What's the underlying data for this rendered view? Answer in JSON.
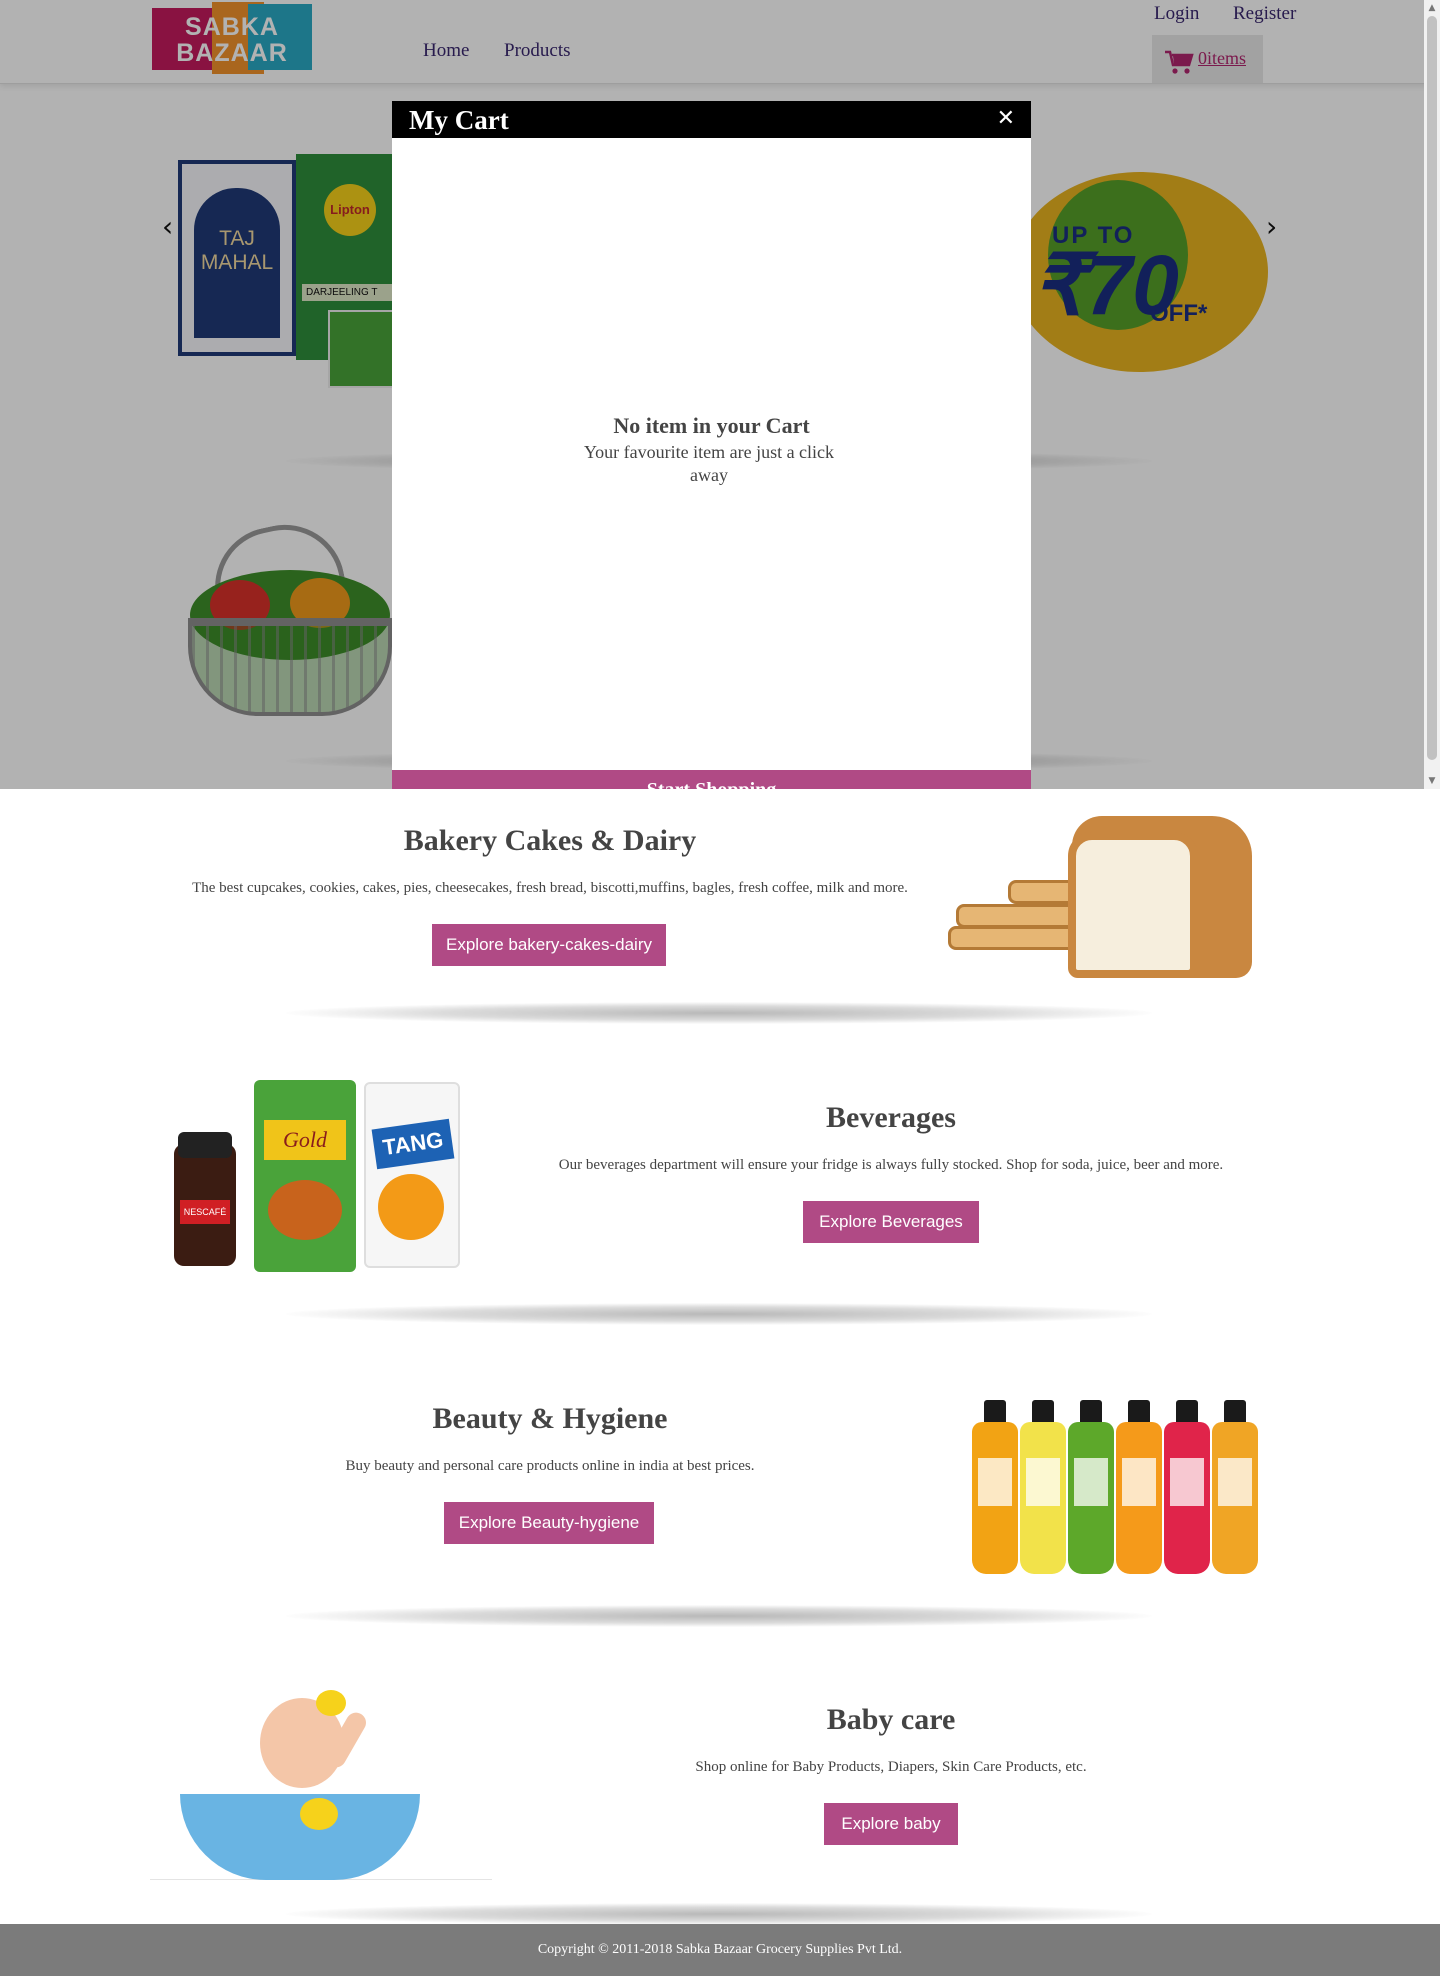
{
  "brand": {
    "logo_line1": "SABKA",
    "logo_line2": "BAZAAR",
    "colors": {
      "magenta": "#c41b5e",
      "orange": "#f2932b",
      "teal": "#2aaac4"
    }
  },
  "nav": {
    "home": "Home",
    "products": "Products"
  },
  "auth": {
    "login": "Login",
    "register": "Register"
  },
  "cart_button": {
    "icon": "cart-icon",
    "count_label": "0items"
  },
  "carousel": {
    "prev": "‹",
    "next": "›",
    "slide": {
      "taj_line1": "TAJ",
      "taj_line2": "MAHAL",
      "lipton": "Lipton",
      "lipton_variant": "DARJEELING T",
      "promo_up_to": "UP TO",
      "promo_value": "₹70",
      "promo_off": "OFF*"
    }
  },
  "categories": [
    {
      "title": "Bakery Cakes & Dairy",
      "description": "The best cupcakes, cookies, cakes, pies, cheesecakes, fresh bread, biscotti,muffins, bagles, fresh coffee, milk and more.",
      "button": "Explore bakery-cakes-dairy"
    },
    {
      "title": "Beverages",
      "description": "Our beverages department will ensure your fridge is always fully stocked. Shop for soda, juice, beer and more.",
      "button": "Explore Beverages",
      "packs": {
        "jar": "NESCAFÉ",
        "gold": "Gold",
        "tang": "TANG"
      }
    },
    {
      "title": "Beauty & Hygiene",
      "description": "Buy beauty and personal care products online in india at best prices.",
      "button": "Explore Beauty-hygiene"
    },
    {
      "title": "Baby care",
      "description": "Shop online for Baby Products, Diapers, Skin Care Products, etc.",
      "button": "Explore baby"
    }
  ],
  "footer": {
    "copyright": "Copyright © 2011-2018 Sabka Bazaar Grocery Supplies Pvt Ltd."
  },
  "cart_modal": {
    "title": "My Cart",
    "close": "✕",
    "empty_title": "No item in your Cart",
    "empty_subtitle": "Your favourite item are just a click away",
    "start_shopping": "Start Shopping"
  },
  "theme": {
    "accent": "#b04a85",
    "modal_header": "#000000",
    "footer_bg": "#7b7b7b",
    "nav_text": "#3a2870"
  }
}
